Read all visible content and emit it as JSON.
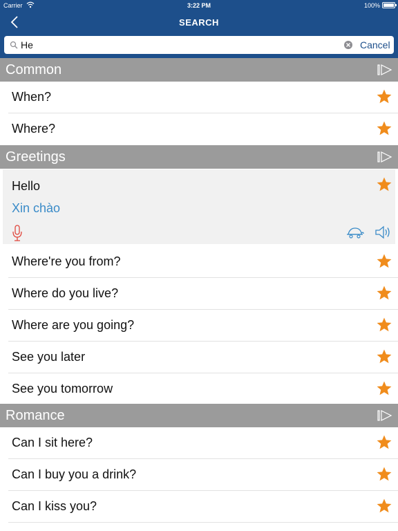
{
  "status_bar": {
    "carrier": "Carrier",
    "time": "3:22 PM",
    "battery": "100%"
  },
  "nav": {
    "title": "SEARCH"
  },
  "search": {
    "value": "He",
    "cancel_label": "Cancel"
  },
  "colors": {
    "header_blue": "#1d4f8b",
    "section_gray": "#9b9b9b",
    "star_orange": "#f08c1c",
    "translation_blue": "#3a8bc8",
    "mic_red": "#e0463c"
  },
  "sections": [
    {
      "label": "Common",
      "items": [
        "When?",
        "Where?"
      ]
    },
    {
      "label": "Greetings",
      "expanded": {
        "text": "Hello",
        "translation": "Xin chào"
      },
      "items": [
        "Where're you from?",
        "Where do you live?",
        "Where are you going?",
        "See you later",
        "See you tomorrow"
      ]
    },
    {
      "label": "Romance",
      "items": [
        "Can I sit here?",
        "Can I buy you a drink?",
        "Can I kiss you?"
      ]
    }
  ]
}
